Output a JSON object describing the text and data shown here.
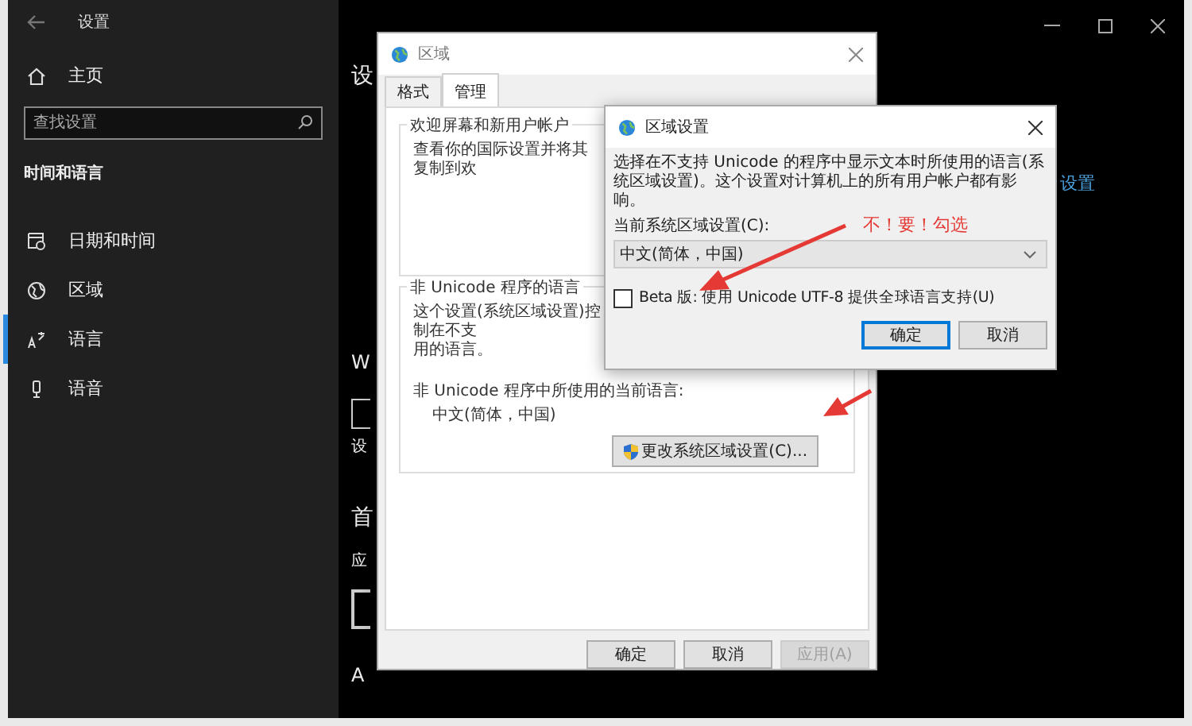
{
  "settings_window": {
    "title": "设置",
    "home": "主页",
    "search": {
      "placeholder": "查找设置"
    },
    "section": "时间和语言",
    "nav": [
      {
        "label": "日期和时间",
        "selected": false
      },
      {
        "label": "区域",
        "selected": false
      },
      {
        "label": "语言",
        "selected": true
      },
      {
        "label": "语音",
        "selected": false
      }
    ],
    "content_fragments": [
      {
        "kind": "heading",
        "text": "设"
      },
      {
        "kind": "letter",
        "text": "W"
      },
      {
        "kind": "box"
      },
      {
        "kind": "small",
        "text": "设"
      },
      {
        "kind": "heading",
        "text": "首"
      },
      {
        "kind": "small",
        "text": "应"
      },
      {
        "kind": "box"
      },
      {
        "kind": "letter",
        "text": "A"
      }
    ],
    "link": "设置"
  },
  "region_dialog": {
    "title": "区域",
    "tabs": [
      {
        "label": "格式",
        "selected": false
      },
      {
        "label": "管理",
        "selected": true
      }
    ],
    "welcome_group": {
      "title": "欢迎屏幕和新用户帐户",
      "text": "查看你的国际设置并将其复制到欢"
    },
    "unicode_group": {
      "title": "非 Unicode 程序的语言",
      "text_lines": [
        "这个设置(系统区域设置)控制在不支",
        "用的语言。"
      ],
      "current_label": "非 Unicode 程序中所使用的当前语言:",
      "current_value": "中文(简体，中国)",
      "change_button": "更改系统区域设置(C)..."
    },
    "buttons": [
      {
        "label": "确定",
        "disabled": false
      },
      {
        "label": "取消",
        "disabled": false
      },
      {
        "label": "应用(A)",
        "disabled": true
      }
    ]
  },
  "region_settings_dialog": {
    "title": "区域设置",
    "description": "选择在不支持 Unicode 的程序中显示文本时所使用的语言(系统区域设置)。这个设置对计算机上的所有用户帐户都有影响。",
    "locale_label": "当前系统区域设置(C):",
    "locale_value": "中文(简体，中国)",
    "beta_option": {
      "label": "Beta 版: 使用 Unicode UTF-8 提供全球语言支持(U)",
      "checked": false
    },
    "buttons": [
      {
        "label": "确定",
        "selected": true
      },
      {
        "label": "取消",
        "selected": false
      }
    ]
  },
  "annotation": {
    "text": "不！要！勾选"
  }
}
